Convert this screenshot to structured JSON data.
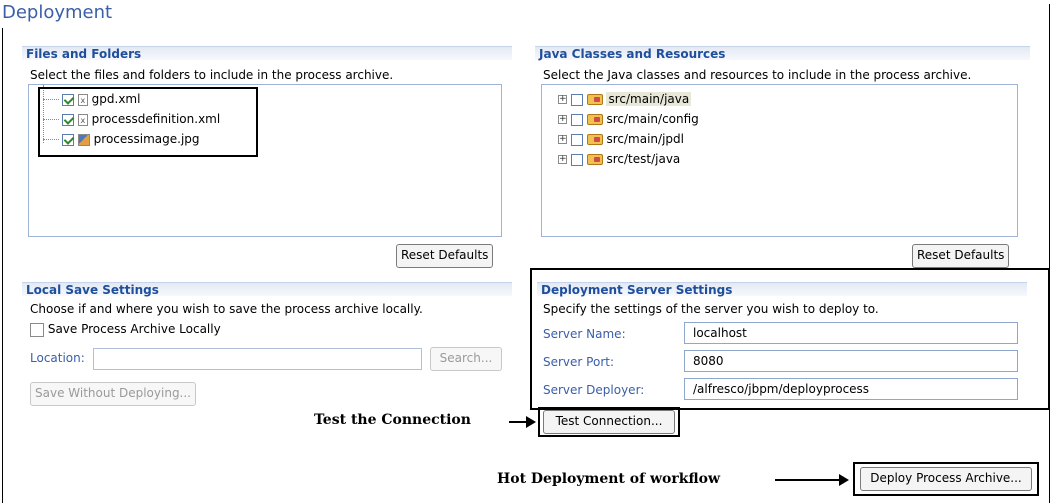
{
  "page": {
    "title": "Deployment"
  },
  "files_and_folders": {
    "header": "Files and Folders",
    "description": "Select the files and folders to include in the process archive.",
    "items": [
      {
        "name": "gpd.xml",
        "checked": true,
        "icon": "xml-file-icon"
      },
      {
        "name": "processdefinition.xml",
        "checked": true,
        "icon": "xml-file-icon"
      },
      {
        "name": "processimage.jpg",
        "checked": true,
        "icon": "image-file-icon"
      }
    ],
    "reset_label": "Reset Defaults"
  },
  "java_classes": {
    "header": "Java Classes and Resources",
    "description": "Select the Java classes and resources to include in the process archive.",
    "items": [
      {
        "name": "src/main/java",
        "checked": false,
        "icon": "package-folder-icon",
        "selected": true
      },
      {
        "name": "src/main/config",
        "checked": false,
        "icon": "package-folder-icon"
      },
      {
        "name": "src/main/jpdl",
        "checked": false,
        "icon": "package-folder-icon"
      },
      {
        "name": "src/test/java",
        "checked": false,
        "icon": "package-folder-icon"
      }
    ],
    "reset_label": "Reset Defaults"
  },
  "local_save": {
    "header": "Local Save Settings",
    "description": "Choose if and where you wish to save the process archive locally.",
    "save_checkbox_label": "Save Process Archive Locally",
    "save_checked": false,
    "location_label": "Location:",
    "location_value": "",
    "search_label": "Search...",
    "save_without_deploying_label": "Save Without Deploying..."
  },
  "server_settings": {
    "header": "Deployment Server Settings",
    "description": "Specify the settings of the server you wish to deploy to.",
    "server_name_label": "Server Name:",
    "server_name_value": "localhost",
    "server_port_label": "Server Port:",
    "server_port_value": "8080",
    "server_deployer_label": "Server Deployer:",
    "server_deployer_value": "/alfresco/jbpm/deployprocess",
    "test_connection_label": "Test Connection...",
    "deploy_label": "Deploy Process Archive..."
  },
  "annotations": {
    "test_connection": "Test the Connection",
    "hot_deployment": "Hot Deployment of workflow"
  },
  "colors": {
    "title": "#3a5ea8",
    "section_header_text": "#1f4f9c",
    "field_label": "#3a5ea8",
    "checkmark": "#2c8a2c"
  }
}
